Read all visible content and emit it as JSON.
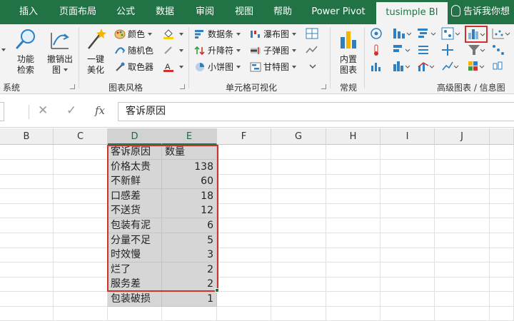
{
  "ribbon": {
    "tabs": [
      {
        "label": "插入",
        "active": false
      },
      {
        "label": "页面布局",
        "active": false
      },
      {
        "label": "公式",
        "active": false
      },
      {
        "label": "数据",
        "active": false
      },
      {
        "label": "审阅",
        "active": false
      },
      {
        "label": "视图",
        "active": false
      },
      {
        "label": "帮助",
        "active": false
      },
      {
        "label": "Power Pivot",
        "active": false
      },
      {
        "label": "tusimple BI",
        "active": true
      }
    ],
    "tell_me": "告诉我你想",
    "groups": {
      "system": {
        "label": "系统",
        "buttons": [
          {
            "label": "功能\n检索",
            "icon": "magnifier-icon"
          },
          {
            "label": "撤销出\n图",
            "icon": "undo-chart-icon"
          }
        ]
      },
      "chart_style": {
        "label": "图表风格",
        "beautify": {
          "label": "一键\n美化",
          "icon": "magic-wand-icon"
        },
        "items": [
          {
            "label": "颜色",
            "icon": "palette-icon"
          },
          {
            "label": "随机色",
            "icon": "random-color-icon"
          },
          {
            "label": "取色器",
            "icon": "eyedropper-icon"
          }
        ]
      },
      "cell_viz": {
        "label": "单元格可视化",
        "items": [
          {
            "label": "数据条",
            "icon": "data-bar-icon"
          },
          {
            "label": "升降符",
            "icon": "up-down-arrow-icon"
          },
          {
            "label": "小饼图",
            "icon": "mini-pie-icon"
          },
          {
            "label": "瀑布图",
            "icon": "waterfall-icon"
          },
          {
            "label": "子弹图",
            "icon": "bullet-chart-icon"
          },
          {
            "label": "甘特图",
            "icon": "gantt-icon"
          }
        ]
      },
      "common": {
        "label": "常规",
        "button": {
          "label": "内置\n图表",
          "icon": "builtin-chart-icon"
        }
      },
      "advanced": {
        "label": "高级图表 / 信息图"
      }
    },
    "colors": {
      "accent": "#217346",
      "highlight": "#d0312d"
    }
  },
  "formula_bar": {
    "cancel": "✕",
    "enter": "✓",
    "fx": "fx",
    "value": "客诉原因"
  },
  "sheet": {
    "columns": [
      "B",
      "C",
      "D",
      "E",
      "F",
      "G",
      "H",
      "I",
      "J"
    ],
    "selected_columns": [
      "D",
      "E"
    ],
    "table": [
      {
        "reason": "客诉原因",
        "count": "数量"
      },
      {
        "reason": "价格太贵",
        "count": "138"
      },
      {
        "reason": "不新鲜",
        "count": "60"
      },
      {
        "reason": "口感差",
        "count": "18"
      },
      {
        "reason": "不送货",
        "count": "12"
      },
      {
        "reason": "包装有泥",
        "count": "6"
      },
      {
        "reason": "分量不足",
        "count": "5"
      },
      {
        "reason": "时效慢",
        "count": "3"
      },
      {
        "reason": "烂了",
        "count": "2"
      },
      {
        "reason": "服务差",
        "count": "2"
      },
      {
        "reason": "包装破损",
        "count": "1"
      }
    ]
  }
}
